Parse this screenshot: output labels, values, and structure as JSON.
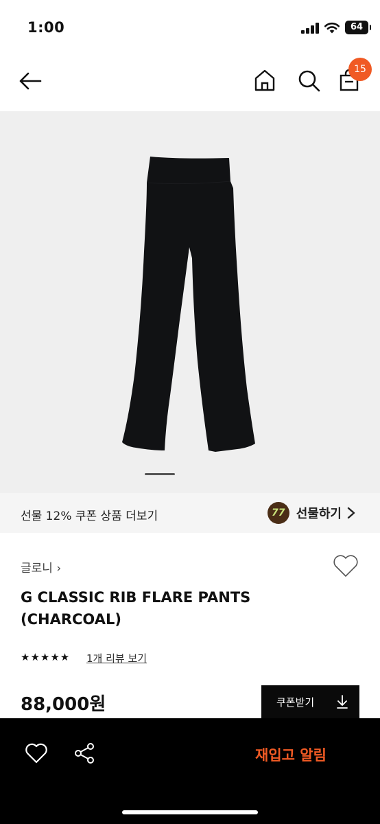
{
  "status_bar": {
    "time": "1:00",
    "battery": "64"
  },
  "header": {
    "cart_count": "15"
  },
  "gift_banner": {
    "text": "선물 12% 쿠폰 상품 더보기",
    "action_label": "선물하기"
  },
  "product": {
    "brand": "글로니 ›",
    "title": "G CLASSIC RIB FLARE PANTS (CHARCOAL)",
    "rating_stars": "★★★★★",
    "rating": 5,
    "review_link": "1개 리뷰 보기",
    "price": "88,000원",
    "coupon_button_label": "쿠폰받기"
  },
  "bottom_bar": {
    "restock_label": "재입고 알림"
  },
  "colors": {
    "accent": "#f05a24",
    "bar": "#000000",
    "image_bg": "#efefef"
  }
}
